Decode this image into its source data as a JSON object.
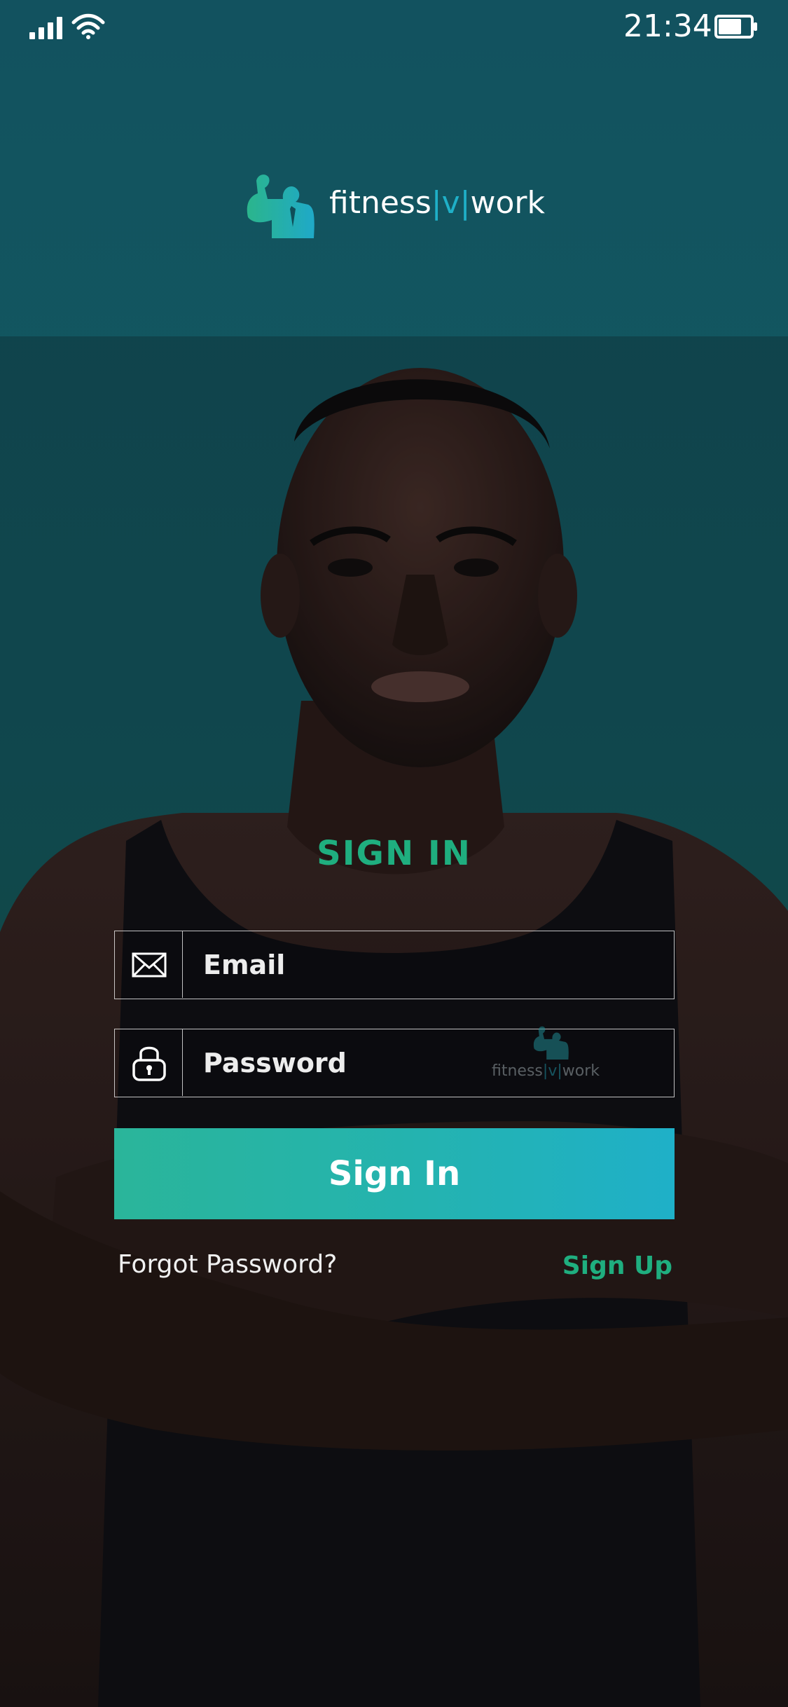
{
  "status_bar": {
    "time": "21:34",
    "signal_icon": "cellular-signal-icon",
    "wifi_icon": "wifi-icon",
    "battery_icon": "battery-icon"
  },
  "logo": {
    "text_before": "fitness",
    "separator_left": "|",
    "accent": "v",
    "separator_right": "|",
    "text_after": "work",
    "icon": "flexing-businessman-logo-icon"
  },
  "form": {
    "title": "SIGN IN",
    "email": {
      "placeholder": "Email",
      "value": "",
      "icon": "envelope-icon"
    },
    "password": {
      "placeholder": "Password",
      "value": "",
      "icon": "padlock-icon"
    },
    "submit_label": "Sign In",
    "forgot_label": "Forgot Password?",
    "signup_label": "Sign Up"
  },
  "colors": {
    "background_top": "#12525f",
    "background_bottom": "#176247",
    "accent_green": "#1fae7f",
    "accent_cyan": "#1fb0c8",
    "button_gradient_start": "#2ab59a",
    "button_gradient_end": "#1fb0c8",
    "text_light": "#ffffff"
  }
}
